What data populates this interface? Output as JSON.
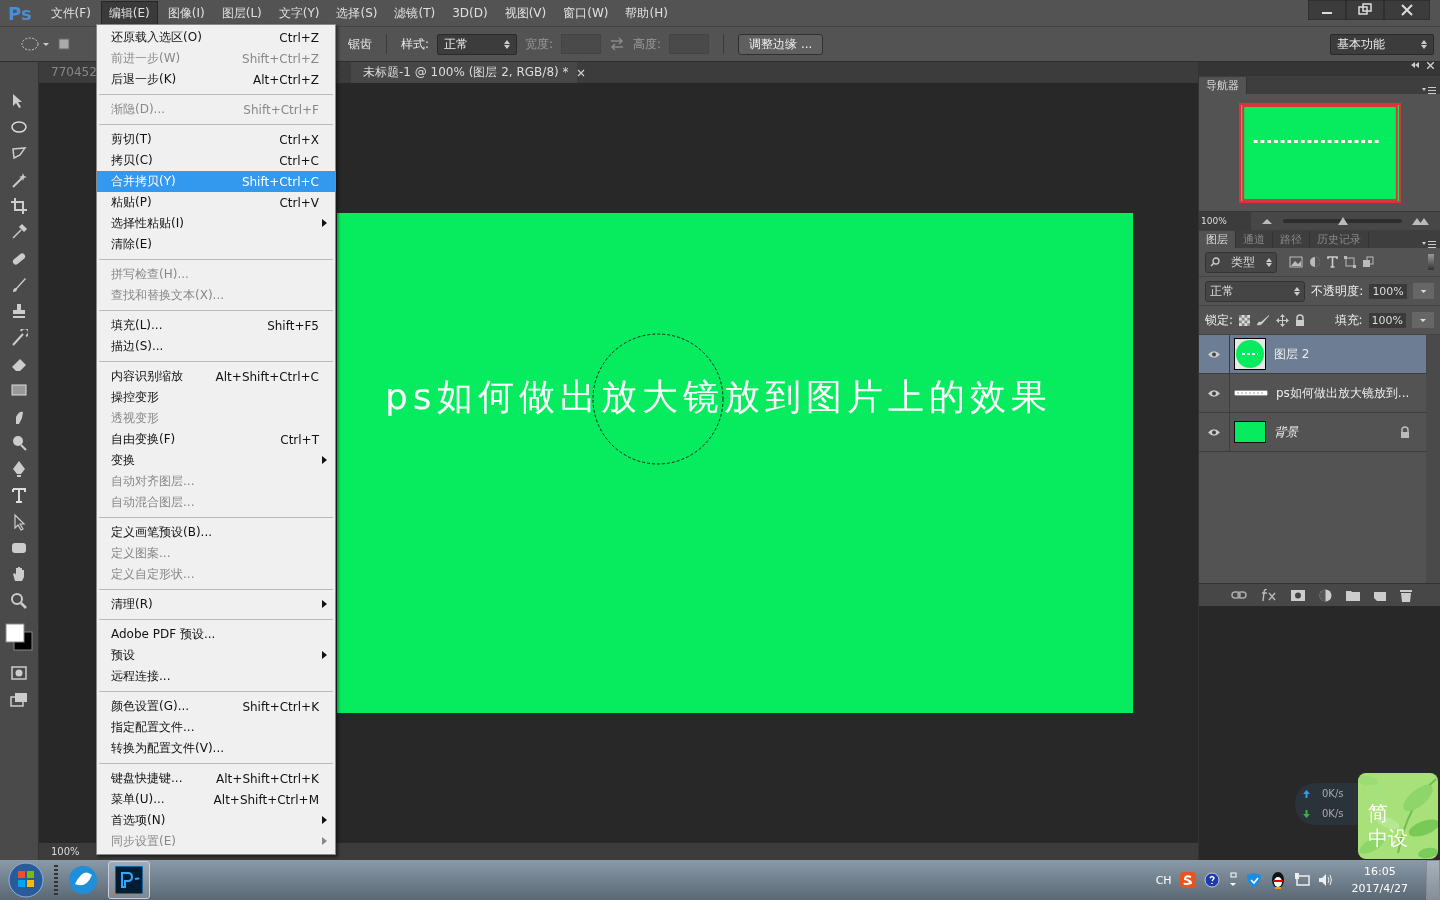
{
  "app": {
    "logo": "Ps"
  },
  "menubar": [
    {
      "label": "文件(F)",
      "selected": false
    },
    {
      "label": "编辑(E)",
      "selected": true
    },
    {
      "label": "图像(I)",
      "selected": false
    },
    {
      "label": "图层(L)",
      "selected": false
    },
    {
      "label": "文字(Y)",
      "selected": false
    },
    {
      "label": "选择(S)",
      "selected": false
    },
    {
      "label": "滤镜(T)",
      "selected": false
    },
    {
      "label": "3D(D)",
      "selected": false
    },
    {
      "label": "视图(V)",
      "selected": false
    },
    {
      "label": "窗口(W)",
      "selected": false
    },
    {
      "label": "帮助(H)",
      "selected": false
    }
  ],
  "options_bar": {
    "antialias_label": "锯齿",
    "style_label": "样式:",
    "style_value": "正常",
    "width_label": "宽度:",
    "height_label": "高度:",
    "refine_button": "调整边缘 ...",
    "workspace": "基本功能"
  },
  "doc_tabs": [
    {
      "label": "770452",
      "selected": false
    },
    {
      "label": "未标题-1 @ 100% (图层 2, RGB/8) *",
      "selected": true
    }
  ],
  "edit_menu": [
    {
      "kind": "item",
      "label": "还原载入选区(O)",
      "shortcut": "Ctrl+Z",
      "disabled": false,
      "selected": false,
      "submenu": false
    },
    {
      "kind": "item",
      "label": "前进一步(W)",
      "shortcut": "Shift+Ctrl+Z",
      "disabled": true,
      "selected": false,
      "submenu": false
    },
    {
      "kind": "item",
      "label": "后退一步(K)",
      "shortcut": "Alt+Ctrl+Z",
      "disabled": false,
      "selected": false,
      "submenu": false
    },
    {
      "kind": "separator"
    },
    {
      "kind": "item",
      "label": "渐隐(D)...",
      "shortcut": "Shift+Ctrl+F",
      "disabled": true,
      "selected": false,
      "submenu": false
    },
    {
      "kind": "separator"
    },
    {
      "kind": "item",
      "label": "剪切(T)",
      "shortcut": "Ctrl+X",
      "disabled": false,
      "selected": false,
      "submenu": false
    },
    {
      "kind": "item",
      "label": "拷贝(C)",
      "shortcut": "Ctrl+C",
      "disabled": false,
      "selected": false,
      "submenu": false
    },
    {
      "kind": "item",
      "label": "合并拷贝(Y)",
      "shortcut": "Shift+Ctrl+C",
      "disabled": false,
      "selected": true,
      "submenu": false
    },
    {
      "kind": "item",
      "label": "粘贴(P)",
      "shortcut": "Ctrl+V",
      "disabled": false,
      "selected": false,
      "submenu": false
    },
    {
      "kind": "item",
      "label": "选择性粘贴(I)",
      "disabled": false,
      "selected": false,
      "submenu": true
    },
    {
      "kind": "item",
      "label": "清除(E)",
      "disabled": false,
      "selected": false,
      "submenu": false
    },
    {
      "kind": "separator"
    },
    {
      "kind": "item",
      "label": "拼写检查(H)...",
      "disabled": true,
      "selected": false,
      "submenu": false
    },
    {
      "kind": "item",
      "label": "查找和替换文本(X)...",
      "disabled": true,
      "selected": false,
      "submenu": false
    },
    {
      "kind": "separator"
    },
    {
      "kind": "item",
      "label": "填充(L)...",
      "shortcut": "Shift+F5",
      "disabled": false,
      "selected": false,
      "submenu": false
    },
    {
      "kind": "item",
      "label": "描边(S)...",
      "disabled": false,
      "selected": false,
      "submenu": false
    },
    {
      "kind": "separator"
    },
    {
      "kind": "item",
      "label": "内容识别缩放",
      "shortcut": "Alt+Shift+Ctrl+C",
      "disabled": false,
      "selected": false,
      "submenu": false
    },
    {
      "kind": "item",
      "label": "操控变形",
      "disabled": false,
      "selected": false,
      "submenu": false
    },
    {
      "kind": "item",
      "label": "透视变形",
      "disabled": true,
      "selected": false,
      "submenu": false
    },
    {
      "kind": "item",
      "label": "自由变换(F)",
      "shortcut": "Ctrl+T",
      "disabled": false,
      "selected": false,
      "submenu": false
    },
    {
      "kind": "item",
      "label": "变换",
      "disabled": false,
      "selected": false,
      "submenu": true
    },
    {
      "kind": "item",
      "label": "自动对齐图层...",
      "disabled": true,
      "selected": false,
      "submenu": false
    },
    {
      "kind": "item",
      "label": "自动混合图层...",
      "disabled": true,
      "selected": false,
      "submenu": false
    },
    {
      "kind": "separator"
    },
    {
      "kind": "item",
      "label": "定义画笔预设(B)...",
      "disabled": false,
      "selected": false,
      "submenu": false
    },
    {
      "kind": "item",
      "label": "定义图案...",
      "disabled": true,
      "selected": false,
      "submenu": false
    },
    {
      "kind": "item",
      "label": "定义自定形状...",
      "disabled": true,
      "selected": false,
      "submenu": false
    },
    {
      "kind": "separator"
    },
    {
      "kind": "item",
      "label": "清理(R)",
      "disabled": false,
      "selected": false,
      "submenu": true
    },
    {
      "kind": "separator"
    },
    {
      "kind": "item",
      "label": "Adobe PDF 预设...",
      "disabled": false,
      "selected": false,
      "submenu": false
    },
    {
      "kind": "item",
      "label": "预设",
      "disabled": false,
      "selected": false,
      "submenu": true
    },
    {
      "kind": "item",
      "label": "远程连接...",
      "disabled": false,
      "selected": false,
      "submenu": false
    },
    {
      "kind": "separator"
    },
    {
      "kind": "item",
      "label": "颜色设置(G)...",
      "shortcut": "Shift+Ctrl+K",
      "disabled": false,
      "selected": false,
      "submenu": false
    },
    {
      "kind": "item",
      "label": "指定配置文件...",
      "disabled": false,
      "selected": false,
      "submenu": false
    },
    {
      "kind": "item",
      "label": "转换为配置文件(V)...",
      "disabled": false,
      "selected": false,
      "submenu": false
    },
    {
      "kind": "separator"
    },
    {
      "kind": "item",
      "label": "键盘快捷键...",
      "shortcut": "Alt+Shift+Ctrl+K",
      "disabled": false,
      "selected": false,
      "submenu": false
    },
    {
      "kind": "item",
      "label": "菜单(U)...",
      "shortcut": "Alt+Shift+Ctrl+M",
      "disabled": false,
      "selected": false,
      "submenu": false
    },
    {
      "kind": "item",
      "label": "首选项(N)",
      "disabled": false,
      "selected": false,
      "submenu": true
    },
    {
      "kind": "item",
      "label": "同步设置(E)",
      "disabled": true,
      "selected": false,
      "submenu": true
    }
  ],
  "canvas": {
    "text": "ps如何做出放大镜放到图片上的效果",
    "zoom": "100%"
  },
  "navigator": {
    "tab": "导航器",
    "zoom": "100%",
    "level": 0.5
  },
  "layers_panel": {
    "tabs": [
      {
        "label": "图层",
        "selected": true
      },
      {
        "label": "通道",
        "selected": false
      },
      {
        "label": "路径",
        "selected": false
      },
      {
        "label": "历史记录",
        "selected": false
      }
    ],
    "filter": "类型",
    "blend_mode": "正常",
    "opacity_label": "不透明度:",
    "opacity": "100%",
    "lock_label": "锁定:",
    "fill_label": "填充:",
    "fill": "100%",
    "layers": [
      {
        "kind": "shape",
        "name": "图层 2",
        "visible": true,
        "selected": true,
        "locked": false
      },
      {
        "kind": "text",
        "name": "ps如何做出放大镜放到...",
        "visible": true,
        "selected": false,
        "locked": false
      },
      {
        "kind": "fill",
        "name": "背景",
        "visible": true,
        "selected": false,
        "locked": true
      }
    ]
  },
  "net_widget": {
    "up": "0K/s",
    "down": "0K/s"
  },
  "ime_widget": {
    "line1": "简",
    "line2": "中设"
  },
  "taskbar": {
    "lang": "CH",
    "time": "16:05",
    "date": "2017/4/27"
  }
}
